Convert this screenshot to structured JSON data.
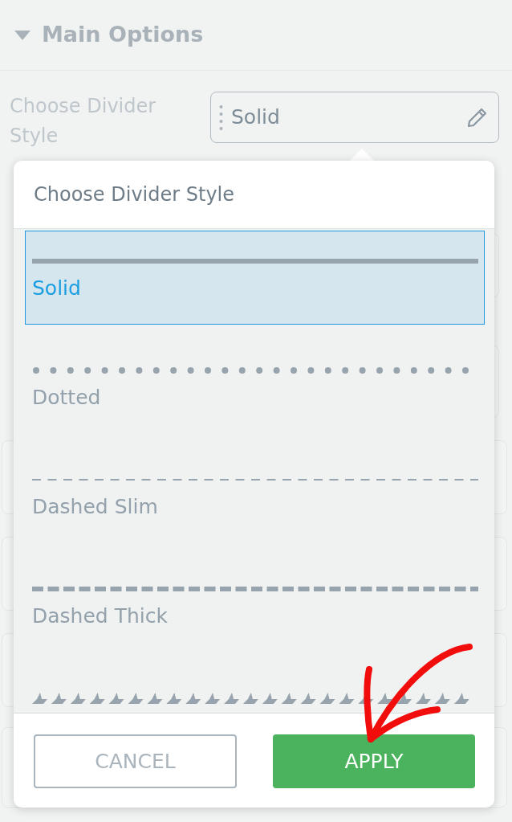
{
  "section": {
    "title": "Main Options",
    "expanded": true
  },
  "field": {
    "label": "Choose Divider Style",
    "value": "Solid"
  },
  "popup": {
    "title": "Choose Divider Style",
    "options": [
      {
        "kind": "solid",
        "label": "Solid",
        "selected": true
      },
      {
        "kind": "dotted",
        "label": "Dotted",
        "selected": false
      },
      {
        "kind": "dashed-slim",
        "label": "Dashed Slim",
        "selected": false
      },
      {
        "kind": "dashed-thick",
        "label": "Dashed Thick",
        "selected": false
      },
      {
        "kind": "stars",
        "selected": false
      }
    ],
    "buttons": [
      {
        "kind": "cancel",
        "label": "CANCEL"
      },
      {
        "kind": "apply",
        "label": "APPLY"
      }
    ]
  }
}
